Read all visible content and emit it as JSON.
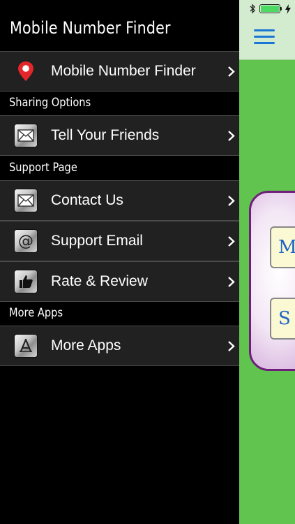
{
  "drawer": {
    "title": "Mobile Number Finder",
    "top_item": {
      "label": "Mobile Number Finder",
      "icon": "map-pin-icon"
    },
    "sections": [
      {
        "header": "Sharing Options",
        "items": [
          {
            "label": "Tell Your Friends",
            "icon": "envelope-icon"
          }
        ]
      },
      {
        "header": "Support Page",
        "items": [
          {
            "label": "Contact Us",
            "icon": "envelope-icon"
          },
          {
            "label": "Support Email",
            "icon": "at-sign-icon"
          },
          {
            "label": "Rate & Review",
            "icon": "thumbs-up-icon"
          }
        ]
      },
      {
        "header": "More Apps",
        "items": [
          {
            "label": "More Apps",
            "icon": "app-store-icon"
          }
        ]
      }
    ]
  },
  "main": {
    "menu_icon": "hamburger-icon",
    "card_buttons": [
      {
        "label": "M"
      },
      {
        "label": "S"
      }
    ]
  },
  "colors": {
    "drawer_bg": "#000000",
    "row_bg": "#212121",
    "main_bg": "#61c44f",
    "header_bg": "#d3ecd0",
    "accent_blue": "#1a75d6",
    "card_border": "#6e1f7a",
    "pin_red": "#e3262b"
  }
}
